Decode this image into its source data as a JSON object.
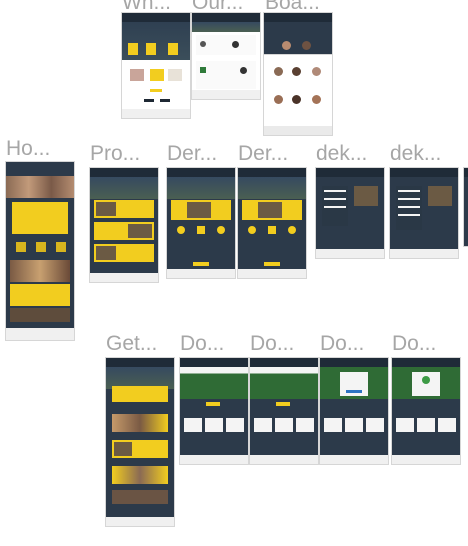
{
  "canvas": {
    "background": "#ffffff",
    "label_color": "#a6a6a6",
    "artboards": [
      {
        "key": "what_we_do",
        "label": "Wh..."
      },
      {
        "key": "our_partners",
        "label": "Our..."
      },
      {
        "key": "board",
        "label": "Boa..."
      },
      {
        "key": "home",
        "label": "Ho..."
      },
      {
        "key": "programs",
        "label": "Pro..."
      },
      {
        "key": "der_1",
        "label": "Der..."
      },
      {
        "key": "der_2",
        "label": "Der..."
      },
      {
        "key": "dek_1",
        "label": "dek..."
      },
      {
        "key": "dek_2",
        "label": "dek..."
      },
      {
        "key": "get_involved",
        "label": "Get..."
      },
      {
        "key": "do_1",
        "label": "Do..."
      },
      {
        "key": "do_2",
        "label": "Do..."
      },
      {
        "key": "do_3",
        "label": "Do..."
      },
      {
        "key": "do_4",
        "label": "Do..."
      }
    ]
  }
}
